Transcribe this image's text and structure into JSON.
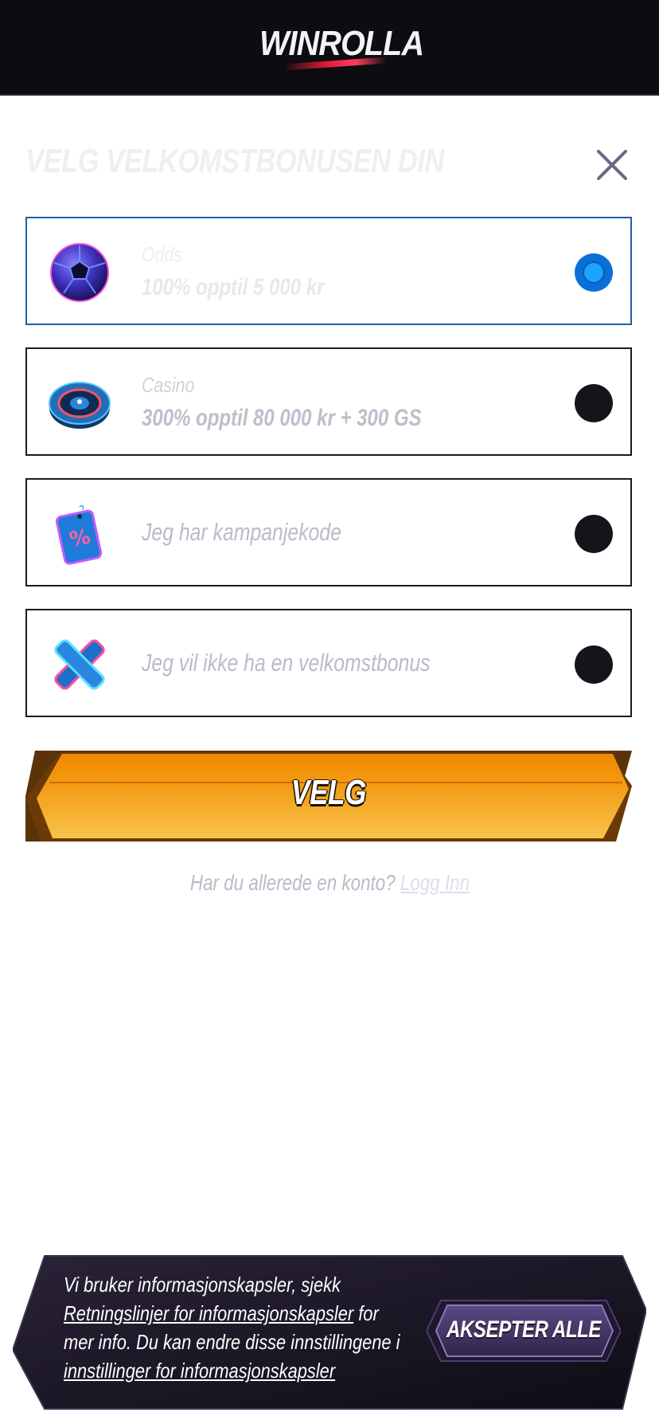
{
  "header": {
    "logo_text": "WINROLLA"
  },
  "modal": {
    "title": "VELG VELKOMSTBONUSEN DIN",
    "options": [
      {
        "label": "Odds",
        "amount": "100% opptil 5 000 kr",
        "selected": true,
        "icon": "football-icon"
      },
      {
        "label": "Casino",
        "amount": "300% opptil 80 000 kr + 300 GS",
        "selected": false,
        "icon": "roulette-icon"
      },
      {
        "label": "Jeg har kampanjekode",
        "selected": false,
        "icon": "promo-tag-icon"
      },
      {
        "label": "Jeg vil ikke ha en velkomstbonus",
        "selected": false,
        "icon": "x-mark-icon"
      }
    ],
    "select_button": "VELG",
    "login_prompt": "Har du allerede en konto?",
    "login_link": "Logg Inn"
  },
  "cookie_banner": {
    "line1": "Vi bruker informasjonskapsler, sjekk",
    "link1": "Retningslinjer for informasjonskapsler",
    "after_link1": " for",
    "line3": "mer info. Du kan endre disse innstillingene i",
    "link2": "innstillinger for informasjonskapsler",
    "accept_button": "AKSEPTER ALLE"
  },
  "colors": {
    "accent_blue": "#0b6fd8",
    "button_orange": "#f29a12",
    "dark": "#0d0c10"
  }
}
